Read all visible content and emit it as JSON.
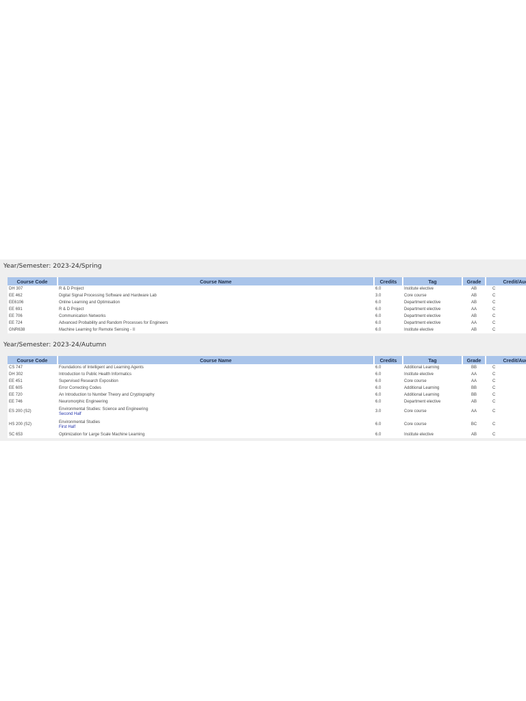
{
  "columns": [
    "Course Code",
    "Course Name",
    "Credits",
    "Tag",
    "Grade",
    "Credit/Audit"
  ],
  "semesters": [
    {
      "title": "Year/Semester: 2023-24/Spring",
      "rows": [
        {
          "code": "DH 307",
          "name": "R & D Project",
          "credits": "6.0",
          "tag": "Institute elective",
          "grade": "AB",
          "credit_audit": "C"
        },
        {
          "code": "EE 462",
          "name": "Digital Signal Processing Software and Hardware Lab",
          "credits": "3.0",
          "tag": "Core course",
          "grade": "AB",
          "credit_audit": "C"
        },
        {
          "code": "EE6106",
          "name": "Online Learning and Optimisation",
          "credits": "6.0",
          "tag": "Department elective",
          "grade": "AB",
          "credit_audit": "C"
        },
        {
          "code": "EE 691",
          "name": "R & D Project",
          "credits": "6.0",
          "tag": "Department elective",
          "grade": "AA",
          "credit_audit": "C"
        },
        {
          "code": "EE 706",
          "name": "Communication Networks",
          "credits": "6.0",
          "tag": "Department elective",
          "grade": "AB",
          "credit_audit": "C"
        },
        {
          "code": "EE 724",
          "name": "Advanced Probability and Random Processes for Engineers",
          "credits": "6.0",
          "tag": "Department elective",
          "grade": "AA",
          "credit_audit": "C"
        },
        {
          "code": "GNR638",
          "name": "Machine Learning for Remote Sensing - II",
          "credits": "6.0",
          "tag": "Institute elective",
          "grade": "AB",
          "credit_audit": "C"
        }
      ]
    },
    {
      "title": "Year/Semester: 2023-24/Autumn",
      "rows": [
        {
          "code": "CS 747",
          "name": "Foundations of Intelligent and Learning Agents",
          "credits": "6.0",
          "tag": "Additional Learning",
          "grade": "BB",
          "credit_audit": "C"
        },
        {
          "code": "DH 302",
          "name": "Introduction to Public Health Informatics",
          "credits": "6.0",
          "tag": "Institute elective",
          "grade": "AA",
          "credit_audit": "C"
        },
        {
          "code": "EE 451",
          "name": "Supervised Research Exposition",
          "credits": "6.0",
          "tag": "Core course",
          "grade": "AA",
          "credit_audit": "C"
        },
        {
          "code": "EE 605",
          "name": "Error Correcting Codes",
          "credits": "6.0",
          "tag": "Additional Learning",
          "grade": "BB",
          "credit_audit": "C"
        },
        {
          "code": "EE 720",
          "name": "An Introduction to Number Theory and Cryptography",
          "credits": "6.0",
          "tag": "Additional Learning",
          "grade": "BB",
          "credit_audit": "C"
        },
        {
          "code": "EE 746",
          "name": "Neuromorphic Engineering",
          "credits": "6.0",
          "tag": "Department elective",
          "grade": "AB",
          "credit_audit": "C"
        },
        {
          "code": "ES 200 (S2)",
          "name": "Environmental Studies: Science and Engineering",
          "half": "Second Half",
          "credits": "3.0",
          "tag": "Core course",
          "grade": "AA",
          "credit_audit": "C"
        },
        {
          "code": "HS 200 (S2)",
          "name": "Environmental Studies",
          "half": "First Half",
          "credits": "6.0",
          "tag": "Core course",
          "grade": "BC",
          "credit_audit": "C"
        },
        {
          "code": "SC 653",
          "name": "Optimization for Large Scale Machine Learning",
          "credits": "6.0",
          "tag": "Institute elective",
          "grade": "AB",
          "credit_audit": "C"
        }
      ]
    }
  ]
}
